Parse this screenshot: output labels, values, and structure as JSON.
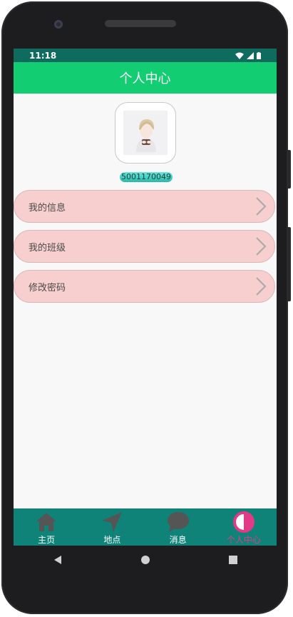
{
  "status": {
    "time": "11:18"
  },
  "header": {
    "title": "个人中心"
  },
  "profile": {
    "user_id": "5001170049"
  },
  "menu": [
    {
      "label": "我的信息"
    },
    {
      "label": "我的班级"
    },
    {
      "label": "修改密码"
    }
  ],
  "bottom_nav": [
    {
      "label": "主页",
      "icon": "home-icon"
    },
    {
      "label": "地点",
      "icon": "navigation-arrow-icon"
    },
    {
      "label": "消息",
      "icon": "chat-bubble-icon"
    },
    {
      "label": "个人中心",
      "icon": "contrast-circle-icon",
      "active": true
    }
  ],
  "colors": {
    "header": "#13cd72",
    "status_bar": "#0e6b5e",
    "menu_item": "#f8cfcf",
    "bottom_nav": "#0f8378",
    "active_nav": "#e23a86"
  }
}
